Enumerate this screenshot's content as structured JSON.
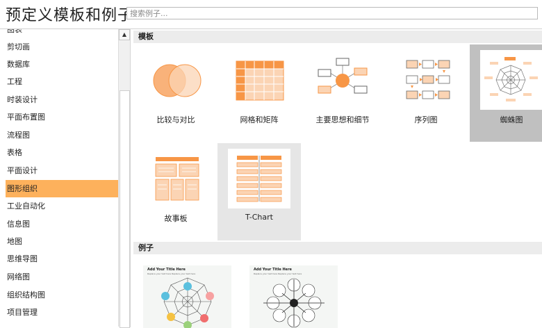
{
  "window": {
    "title": "预定义模板和例子"
  },
  "search": {
    "placeholder": "搜索例子..."
  },
  "categories": [
    "图表",
    "剪切画",
    "数据库",
    "工程",
    "时装设计",
    "平面布置图",
    "流程图",
    "表格",
    "平面设计",
    "图形组织",
    "工业自动化",
    "信息图",
    "地图",
    "思维导图",
    "网络图",
    "组织结构图",
    "项目管理"
  ],
  "selected_category": "图形组织",
  "sections": {
    "templates": "模板",
    "examples": "例子"
  },
  "templates": [
    "比较与对比",
    "网格和矩阵",
    "主要思想和细节",
    "序列图",
    "蜘蛛图",
    "故事板",
    "T-Chart"
  ],
  "selected_template": "蜘蛛图",
  "examples": [
    {
      "heading": "Add Your Title Here",
      "sub": "Replace your text here Replace your text here"
    },
    {
      "heading": "Add Your Title Here",
      "sub": "Replace your text here Replace your text here"
    }
  ],
  "colors": {
    "accent": "#fdb15c",
    "orange": "#f79646",
    "light_orange": "#fbd4b4"
  },
  "icons": {
    "scroll_up": "up-arrow-icon"
  }
}
